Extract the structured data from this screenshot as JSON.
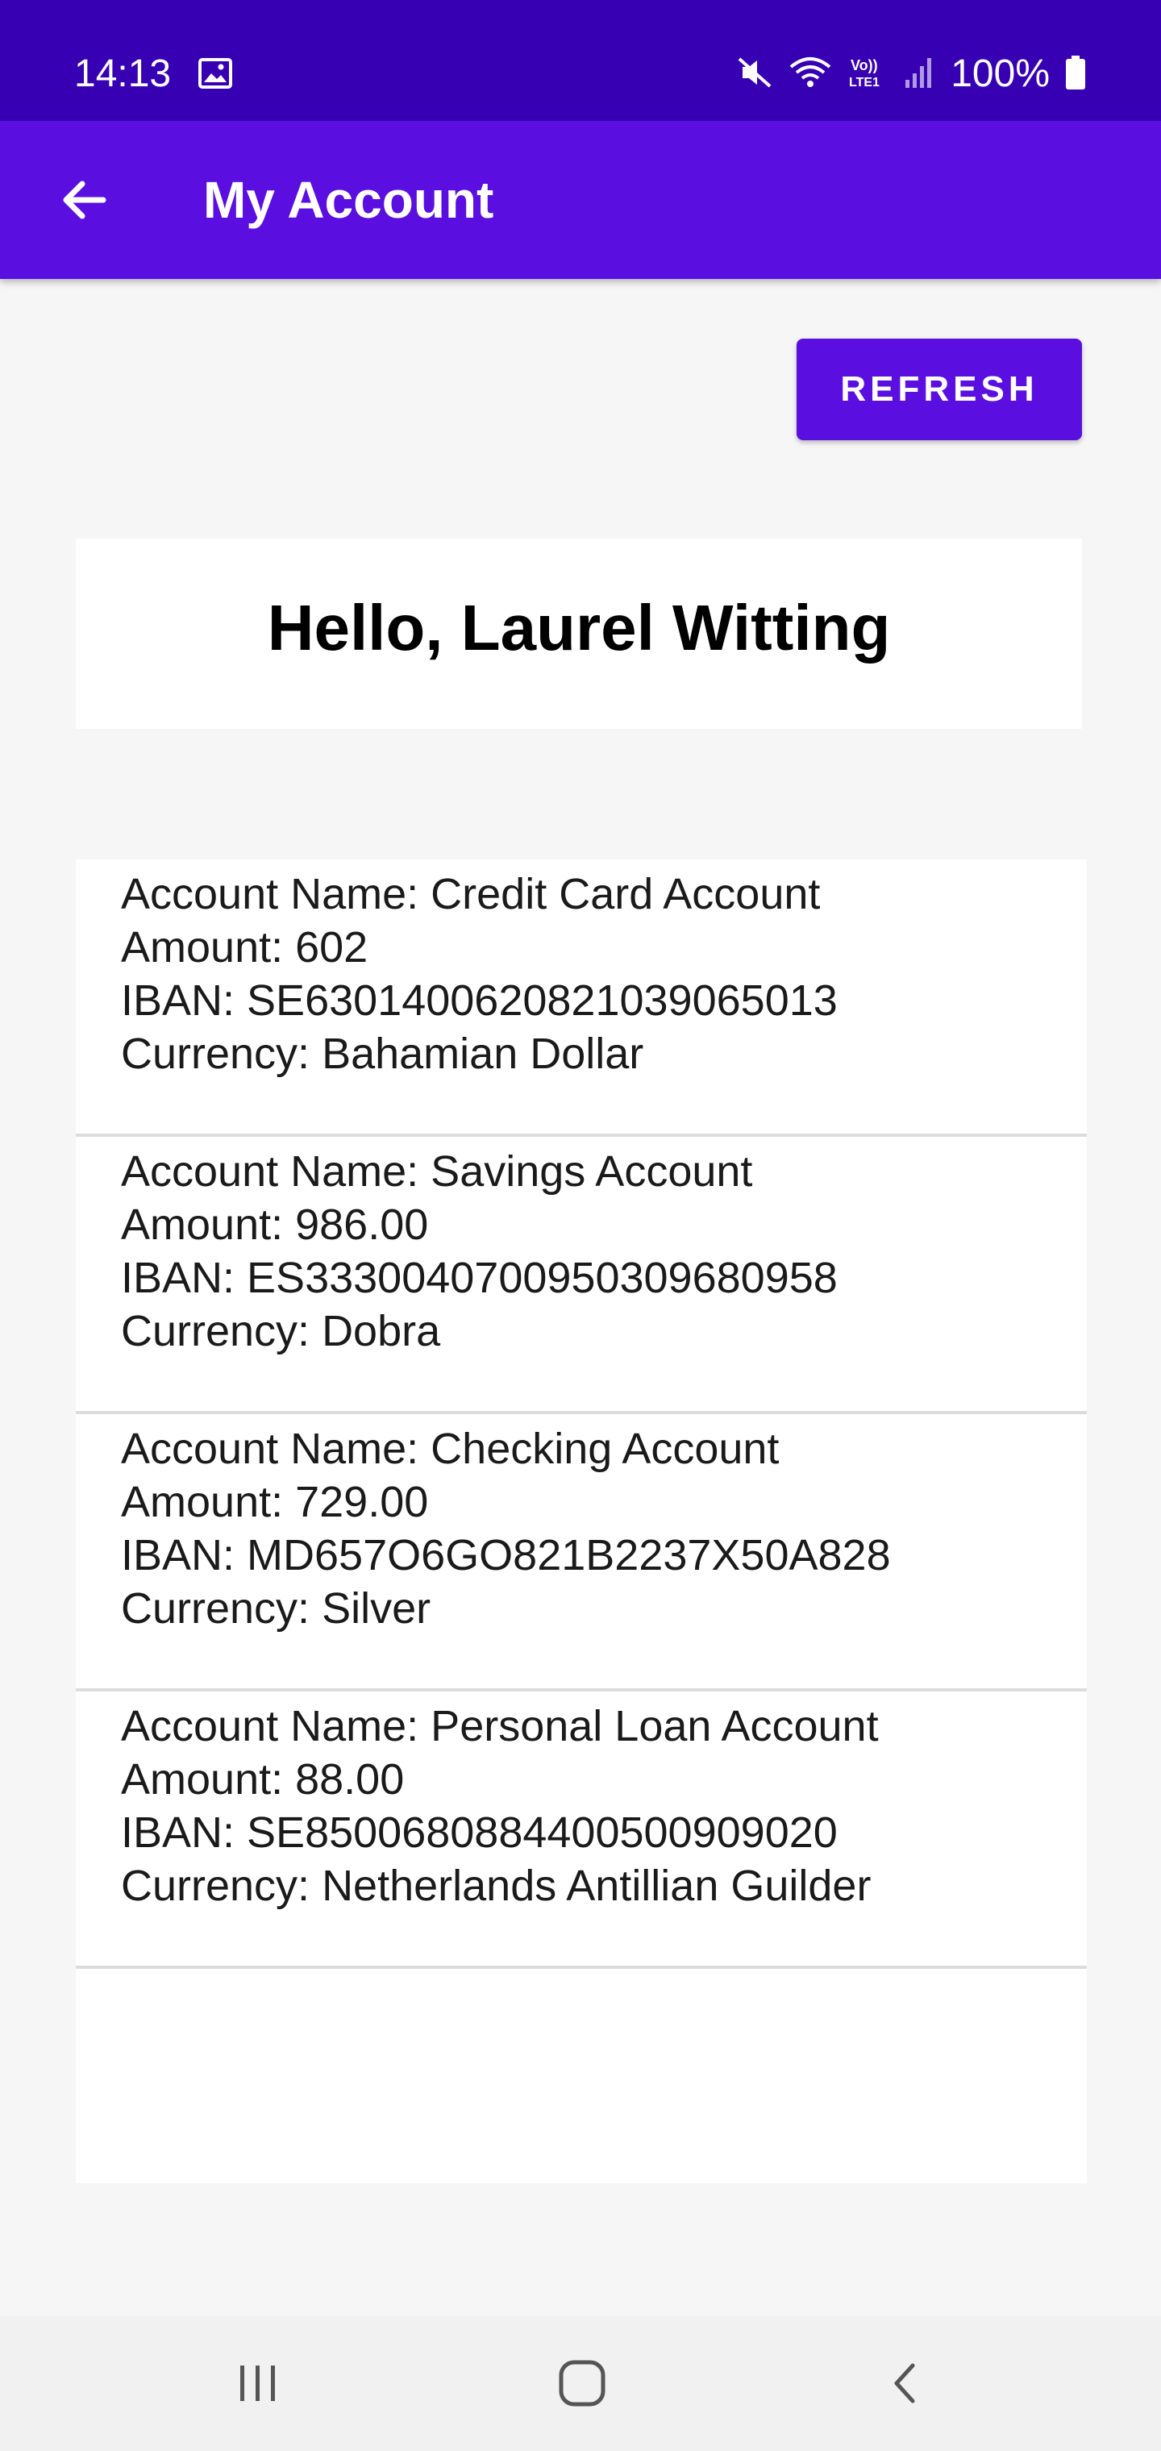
{
  "status_bar": {
    "time": "14:13",
    "battery": "100%",
    "icons": [
      "image-icon",
      "mute-icon",
      "wifi-icon",
      "volte-icon",
      "signal-icon",
      "battery-icon"
    ]
  },
  "app_bar": {
    "title": "My Account",
    "back_icon": "arrow-left-icon"
  },
  "refresh_label": "REFRESH",
  "greeting": "Hello, Laurel Witting",
  "accounts": [
    {
      "name": "Account Name: Credit Card Account",
      "amount": "Amount: 602",
      "iban": "IBAN: SE6301400620821039065013",
      "currency": "Currency: Bahamian Dollar"
    },
    {
      "name": "Account Name: Savings Account",
      "amount": "Amount: 986.00",
      "iban": "IBAN: ES3330040700950309680958",
      "currency": "Currency: Dobra"
    },
    {
      "name": "Account Name: Checking Account",
      "amount": "Amount: 729.00",
      "iban": "IBAN: MD657O6GO821B2237X50A828",
      "currency": "Currency: Silver"
    },
    {
      "name": "Account Name: Personal Loan Account",
      "amount": "Amount: 88.00",
      "iban": "IBAN: SE8500680884400500909020",
      "currency": "Currency: Netherlands Antillian Guilder"
    }
  ],
  "nav_bar": {
    "icons": [
      "recent-apps-icon",
      "home-icon",
      "back-icon"
    ]
  },
  "colors": {
    "status_bar": "#3700b3",
    "primary": "#5a0fe0",
    "background": "#f6f6f6"
  }
}
